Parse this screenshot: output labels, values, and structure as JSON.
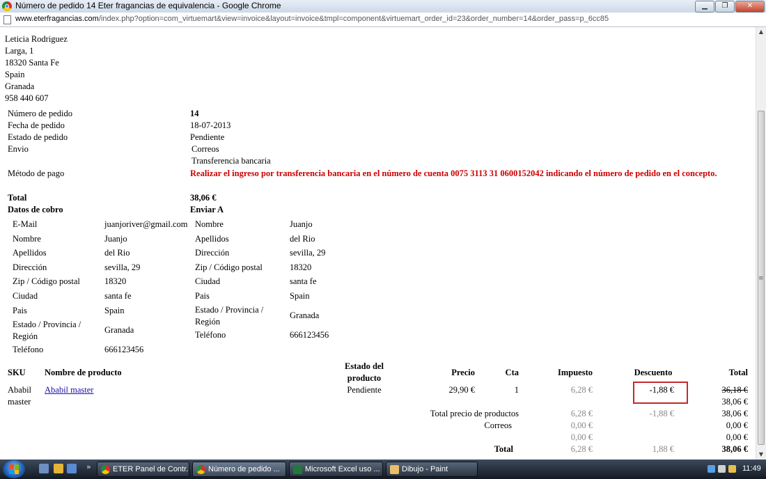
{
  "window": {
    "title": "Número de pedido 14 Eter fragancias de equivalencia - Google Chrome",
    "buttons": {
      "minimize": "▁",
      "maximize": "❐",
      "close": "✕"
    }
  },
  "address": {
    "host": "www.eterfragancias.com",
    "path": "/index.php?option=com_virtuemart&view=invoice&layout=invoice&tmpl=component&virtuemart_order_id=23&order_number=14&order_pass=p_6cc85"
  },
  "customer": {
    "name": "Leticia Rodriguez",
    "street": "Larga, 1",
    "city": "18320 Santa Fe",
    "country": "Spain",
    "region": "Granada",
    "phone": "958 440 607"
  },
  "order": {
    "number_label": "Número de pedido",
    "number": "14",
    "date_label": "Fecha de pedido",
    "date": "18-07-2013",
    "status_label": "Estado de pedido",
    "status": "Pendiente",
    "shipping_label": "Envio",
    "shipping": "Correos",
    "payment_label": "Método de pago",
    "payment": "Transferencia bancaria",
    "payment_note": "Realizar el ingreso por transferencia bancaria en el número de cuenta 0075 3113 31 0600152042 indicando el número de pedido en el concepto.",
    "total_label": "Total",
    "total": "38,06 €"
  },
  "billing": {
    "heading": "Datos de cobro",
    "rows": [
      {
        "label": "E-Mail",
        "value": "juanjoriver@gmail.com"
      },
      {
        "label": "Nombre",
        "value": "Juanjo"
      },
      {
        "label": "Apellidos",
        "value": "del Rio"
      },
      {
        "label": "Dirección",
        "value": "sevilla, 29"
      },
      {
        "label": "Zip / Código postal",
        "value": "18320"
      },
      {
        "label": "Ciudad",
        "value": "santa fe"
      },
      {
        "label": "Pais",
        "value": "Spain"
      },
      {
        "label": "Estado / Provincia / Región",
        "value": "Granada"
      },
      {
        "label": "Teléfono",
        "value": "666123456"
      }
    ]
  },
  "shipping_to": {
    "heading": "Enviar A",
    "rows": [
      {
        "label": "Nombre",
        "value": "Juanjo"
      },
      {
        "label": "Apellidos",
        "value": "del Rio"
      },
      {
        "label": "Dirección",
        "value": "sevilla, 29"
      },
      {
        "label": "Zip / Código postal",
        "value": "18320"
      },
      {
        "label": "Ciudad",
        "value": "santa fe"
      },
      {
        "label": "Pais",
        "value": "Spain"
      },
      {
        "label": "Estado / Provincia / Región",
        "value": "Granada"
      },
      {
        "label": "Teléfono",
        "value": "666123456"
      }
    ]
  },
  "items_table": {
    "headers": {
      "sku": "SKU",
      "name": "Nombre de producto",
      "status": "Estado del producto",
      "price": "Precio",
      "qty": "Cta",
      "tax": "Impuesto",
      "discount": "Descuento",
      "total": "Total"
    },
    "item": {
      "sku": "Ababil master",
      "name": "Ababil master",
      "status": "Pendiente",
      "price": "29,90 €",
      "qty": "1",
      "tax": "6,28 €",
      "discount": "-1,88 €",
      "total_old": "36,18 €",
      "total": "38,06 €"
    },
    "subtotal": {
      "label": "Total precio de productos",
      "tax": "6,28 €",
      "discount": "-1,88 €",
      "total": "38,06 €"
    },
    "shipping_row": {
      "label": "Correos",
      "tax": "0,00 €",
      "total": "0,00 €"
    },
    "payment_row": {
      "tax": "0,00 €",
      "total": "0,00 €"
    },
    "grand_total": {
      "label": "Total",
      "tax": "6,28 €",
      "discount": "1,88 €",
      "total": "38,06 €"
    }
  },
  "taskbar": {
    "tasks": [
      {
        "label": "ETER Panel de Contr...",
        "icon": "chrome-icon"
      },
      {
        "label": "Número de pedido ...",
        "icon": "chrome-icon"
      },
      {
        "label": "Microsoft Excel uso ...",
        "icon": "excel-icon"
      },
      {
        "label": "Dibujo - Paint",
        "icon": "paint-icon"
      }
    ],
    "chevron": "»",
    "clock": "11:49"
  }
}
